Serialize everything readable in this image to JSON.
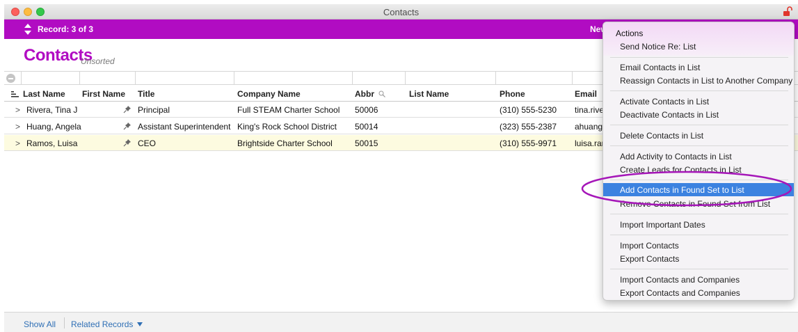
{
  "window": {
    "title": "Contacts"
  },
  "toolbar": {
    "record_label": "Record: 3 of 3",
    "new_label": "New"
  },
  "page": {
    "title": "Contacts",
    "sort_status": "Unsorted"
  },
  "table": {
    "columns": [
      "Last Name",
      "First Name",
      "Title",
      "Company Name",
      "Abbr",
      "List Name",
      "Phone",
      "Email"
    ],
    "rows": [
      {
        "name": "Rivera, Tina J",
        "title": "Principal",
        "company": "Full STEAM Charter School",
        "abbr": "50006",
        "phone": "(310) 555-5230",
        "email": "tina.rive"
      },
      {
        "name": "Huang, Angela",
        "title": "Assistant Superintendent",
        "company": "King's Rock School District",
        "abbr": "50014",
        "phone": "(323) 555-2387",
        "email": "ahuang"
      },
      {
        "name": "Ramos, Luisa",
        "title": "CEO",
        "company": "Brightside Charter School",
        "abbr": "50015",
        "phone": "(310) 555-9971",
        "email": "luisa.ran"
      }
    ]
  },
  "menu": {
    "header": "Actions",
    "items": [
      "Send Notice Re: List",
      "Email Contacts in List",
      "Reassign Contacts in List to Another Company",
      "Activate Contacts in List",
      "Deactivate Contacts in List",
      "Delete Contacts in List",
      "Add Activity to Contacts in List",
      "Create Leads for Contacts in List",
      "Add Contacts in Found Set to List",
      "Remove Contacts in Found Set from List",
      "Import Important Dates",
      "Import Contacts",
      "Export Contacts",
      "Import Contacts and Companies",
      "Export Contacts and Companies"
    ],
    "highlighted_item": "Add Contacts in Found Set to List"
  },
  "footer": {
    "show_all": "Show All",
    "related_records": "Related Records"
  },
  "colors": {
    "accent": "#b10cc2",
    "highlight": "#3c82e0",
    "selected_row": "#fdfbe0",
    "link": "#2f6fb5"
  }
}
